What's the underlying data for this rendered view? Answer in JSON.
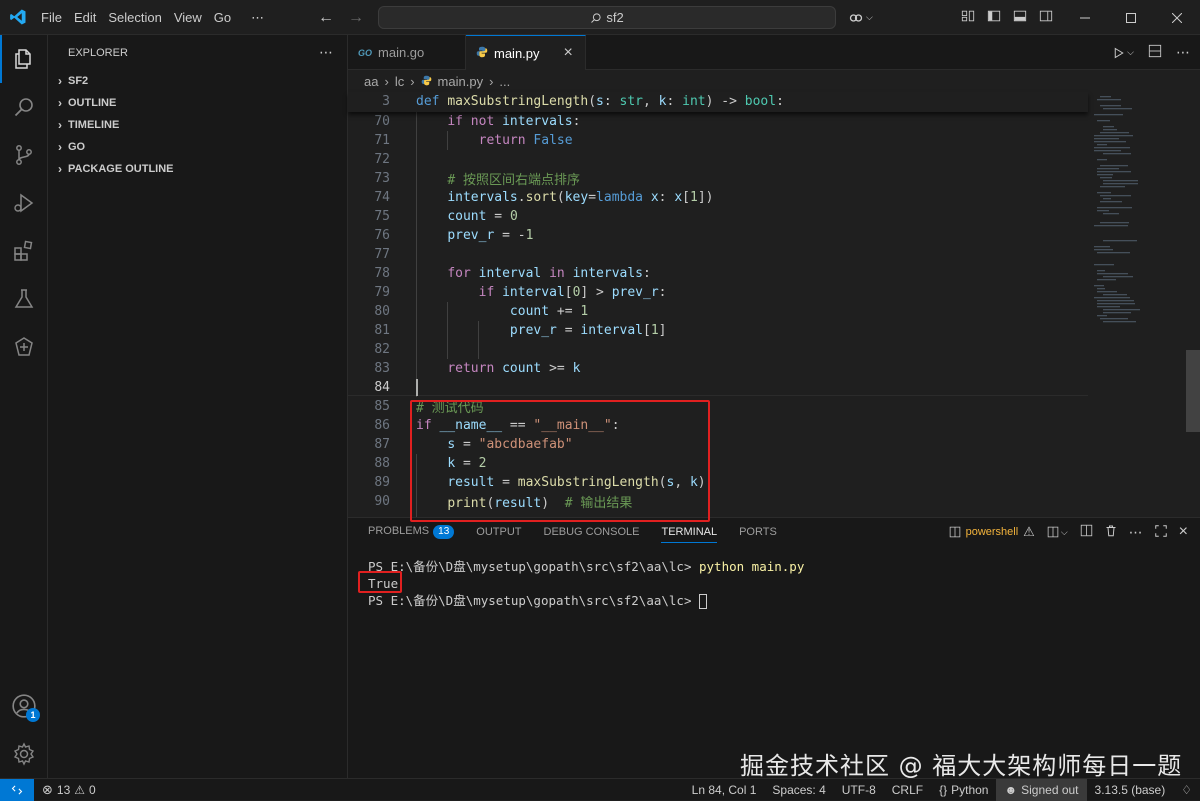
{
  "titlebar": {
    "menu": [
      "File",
      "Edit",
      "Selection",
      "View",
      "Go",
      "⋯"
    ],
    "search_text": "sf2"
  },
  "sidebar": {
    "header": "EXPLORER",
    "more": "⋯",
    "sections": [
      "SF2",
      "OUTLINE",
      "TIMELINE",
      "GO",
      "PACKAGE OUTLINE"
    ]
  },
  "activity_bar": {
    "account_badge": "1",
    "icons": [
      "explorer-icon",
      "search-icon",
      "source-control-icon",
      "run-debug-icon",
      "extensions-icon",
      "testing-icon",
      "remote-icon"
    ]
  },
  "editor": {
    "tabs": [
      {
        "label": "main.go",
        "icon": "GO",
        "active": false
      },
      {
        "label": "main.py",
        "icon": "py",
        "active": true
      }
    ],
    "close_glyph": "×",
    "breadcrumb": [
      "aa",
      "lc",
      "main.py",
      "..."
    ],
    "sticky_line": {
      "num": "3",
      "text": "def maxSubstringLength(s: str, k: int) -> bool:"
    },
    "lines": [
      {
        "num": "70",
        "text": "    if not intervals:"
      },
      {
        "num": "71",
        "text": "        return False"
      },
      {
        "num": "72",
        "text": ""
      },
      {
        "num": "73",
        "text": "    # 按照区间右端点排序"
      },
      {
        "num": "74",
        "text": "    intervals.sort(key=lambda x: x[1])"
      },
      {
        "num": "75",
        "text": "    count = 0"
      },
      {
        "num": "76",
        "text": "    prev_r = -1"
      },
      {
        "num": "77",
        "text": ""
      },
      {
        "num": "78",
        "text": "    for interval in intervals:"
      },
      {
        "num": "79",
        "text": "        if interval[0] > prev_r:"
      },
      {
        "num": "80",
        "text": "            count += 1"
      },
      {
        "num": "81",
        "text": "            prev_r = interval[1]"
      },
      {
        "num": "82",
        "text": ""
      },
      {
        "num": "83",
        "text": "    return count >= k"
      },
      {
        "num": "84",
        "text": ""
      },
      {
        "num": "85",
        "text": "# 测试代码"
      },
      {
        "num": "86",
        "text": "if __name__ == \"__main__\":"
      },
      {
        "num": "87",
        "text": "    s = \"abcdbaefab\""
      },
      {
        "num": "88",
        "text": "    k = 2"
      },
      {
        "num": "89",
        "text": "    result = maxSubstringLength(s, k)"
      },
      {
        "num": "90",
        "text": "    print(result)  # 输出结果"
      }
    ]
  },
  "panel": {
    "tabs": [
      "PROBLEMS",
      "OUTPUT",
      "DEBUG CONSOLE",
      "TERMINAL",
      "PORTS"
    ],
    "problems_count": "13",
    "shell_label": "powershell",
    "terminal": {
      "line1_prompt": "PS E:\\备份\\D盘\\mysetup\\gopath\\src\\sf2\\aa\\lc> ",
      "line1_cmd": "python main.py",
      "line2": "True",
      "line3_prompt": "PS E:\\备份\\D盘\\mysetup\\gopath\\src\\sf2\\aa\\lc> "
    }
  },
  "statusbar": {
    "problems": "13",
    "warnings": "0",
    "position": "Ln 84, Col 1",
    "spaces": "Spaces: 4",
    "encoding": "UTF-8",
    "eol": "CRLF",
    "language": "Python",
    "signed": "Signed out",
    "interpreter": "3.13.5 (base)"
  },
  "watermark": "掘金技术社区 @ 福大大架构师每日一题",
  "colors": {
    "accent": "#0078d4",
    "highlight_box": "#e02020"
  }
}
